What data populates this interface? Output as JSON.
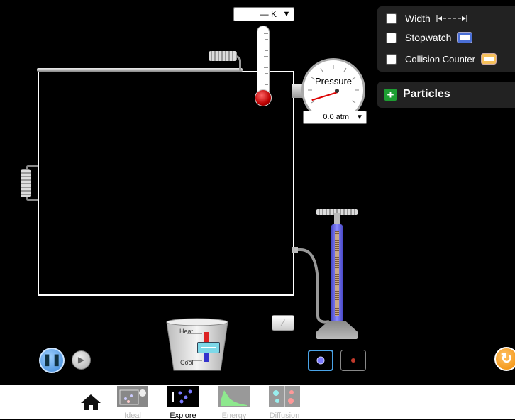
{
  "thermometer": {
    "value": "— K",
    "dropdown_glyph": "▼"
  },
  "pressure": {
    "label": "Pressure",
    "value": "0.0 atm",
    "dropdown_glyph": "▼"
  },
  "options": {
    "width_label": "Width",
    "stopwatch_label": "Stopwatch",
    "collision_label": "Collision Counter"
  },
  "particles_panel": {
    "plus": "+",
    "label": "Particles"
  },
  "heater": {
    "heat_label": "Heat",
    "cool_label": "Cool"
  },
  "playback": {
    "pause_glyph": "❚❚",
    "step_glyph": "▶",
    "reset_glyph": "↻"
  },
  "eraser_glyph": "⁄",
  "navbar": {
    "tabs": [
      {
        "label": "Ideal",
        "selected": false
      },
      {
        "label": "Explore",
        "selected": true
      },
      {
        "label": "Energy",
        "selected": false
      },
      {
        "label": "Diffusion",
        "selected": false
      }
    ]
  },
  "colors": {
    "heavy_particle": "#7a7aff",
    "light_particle": "#c0392b",
    "selected_tab_label": "#000000",
    "unselected_tab_label": "#bbbbbb"
  }
}
